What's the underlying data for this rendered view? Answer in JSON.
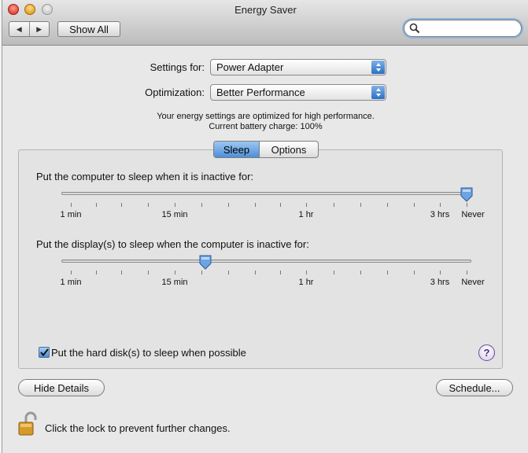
{
  "window": {
    "title": "Energy Saver"
  },
  "toolbar": {
    "back_glyph": "◀",
    "forward_glyph": "▶",
    "show_all_label": "Show All",
    "search_value": ""
  },
  "settings": {
    "settings_for_label": "Settings for:",
    "settings_for_value": "Power Adapter",
    "optimization_label": "Optimization:",
    "optimization_value": "Better Performance",
    "info_line1": "Your energy settings are optimized for high performance.",
    "info_line2": "Current battery charge: 100%"
  },
  "tabs": [
    {
      "label": "Sleep",
      "active": true
    },
    {
      "label": "Options",
      "active": false
    }
  ],
  "computer_sleep": {
    "label": "Put the computer to sleep when it is inactive for:",
    "value_fraction": 1.0,
    "tick_labels": [
      "1 min",
      "15 min",
      "1 hr",
      "3 hrs",
      "Never"
    ]
  },
  "display_sleep": {
    "label": "Put the display(s) to sleep when the computer is inactive for:",
    "value_fraction": 0.339,
    "tick_labels": [
      "1 min",
      "15 min",
      "1 hr",
      "3 hrs",
      "Never"
    ]
  },
  "hard_disk": {
    "label": "Put the hard disk(s) to sleep when possible",
    "checked": true
  },
  "help_glyph": "?",
  "buttons": {
    "hide_details": "Hide Details",
    "schedule": "Schedule..."
  },
  "lock": {
    "text": "Click the lock to prevent further changes."
  },
  "colors": {
    "accent": "#4f8fd7",
    "help": "#4e2a86"
  }
}
